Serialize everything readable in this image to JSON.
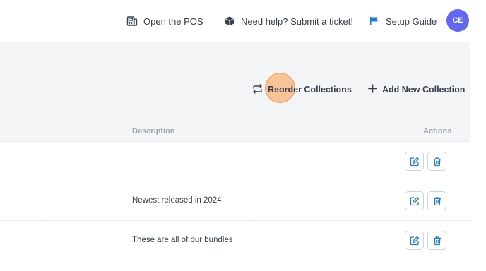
{
  "topbar": {
    "pos_label": "Open the POS",
    "help_label": "Need help? Submit a ticket!",
    "setup_label": "Setup Guide",
    "avatar_initials": "CE"
  },
  "toolbar": {
    "reorder_label": "Reorder Collections",
    "add_label": "Add New Collection"
  },
  "table": {
    "headers": {
      "description": "Description",
      "actions": "Actions"
    },
    "rows": [
      {
        "description": ""
      },
      {
        "description": "Newest released in 2024"
      },
      {
        "description": "These are all of our bundles"
      }
    ]
  },
  "colors": {
    "accent": "#6366f1",
    "flag": "#1e7bd6",
    "action_icon": "#2b7bb9"
  }
}
